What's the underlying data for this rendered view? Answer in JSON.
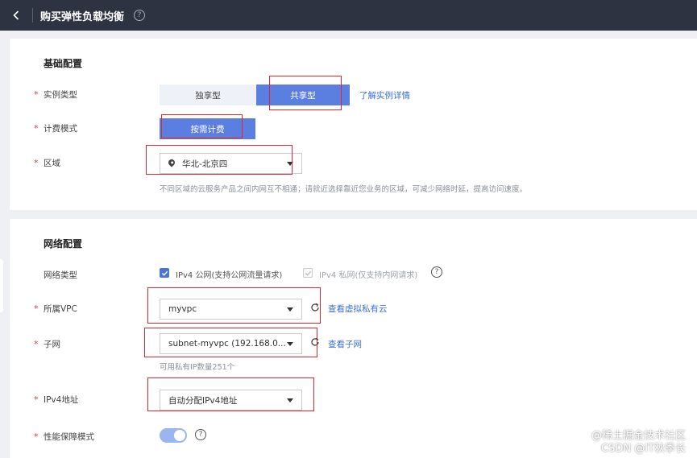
{
  "header": {
    "title": "购买弹性负载均衡",
    "help": "?"
  },
  "basic": {
    "title": "基础配置",
    "instance_type": {
      "label": "实例类型",
      "options": [
        "独享型",
        "共享型"
      ],
      "link": "了解实例详情"
    },
    "billing": {
      "label": "计费模式",
      "option": "按需计费"
    },
    "region": {
      "label": "区域",
      "value": "华北-北京四",
      "hint": "不同区域的云服务产品之间内网互不相通；请就近选择靠近您业务的区域，可减少网络时延，提高访问速度。"
    }
  },
  "network": {
    "title": "网络配置",
    "net_type": {
      "label": "网络类型",
      "ipv4_public": "IPv4 公网",
      "ipv4_public_note": "(支持公网流量请求)",
      "ipv4_private": "IPv4 私网",
      "ipv4_private_note": "(仅支持内网请求)"
    },
    "vpc": {
      "label": "所属VPC",
      "value": "myvpc",
      "link": "查看虚拟私有云"
    },
    "subnet": {
      "label": "子网",
      "value": "subnet-myvpc (192.168.0...",
      "link": "查看子网",
      "hint": "可用私有IP数量251个"
    },
    "ipv4": {
      "label": "IPv4地址",
      "value": "自动分配IPv4地址"
    },
    "perf": {
      "label": "性能保障模式"
    }
  },
  "watermark": {
    "line1": "@稀土掘金技术社区",
    "line2": "CSDN @IT秋季长"
  },
  "colors": {
    "accent": "#5b7fe0",
    "highlight": "#e0262c",
    "link": "#3b6fd8",
    "topbar": "#2d3340"
  }
}
